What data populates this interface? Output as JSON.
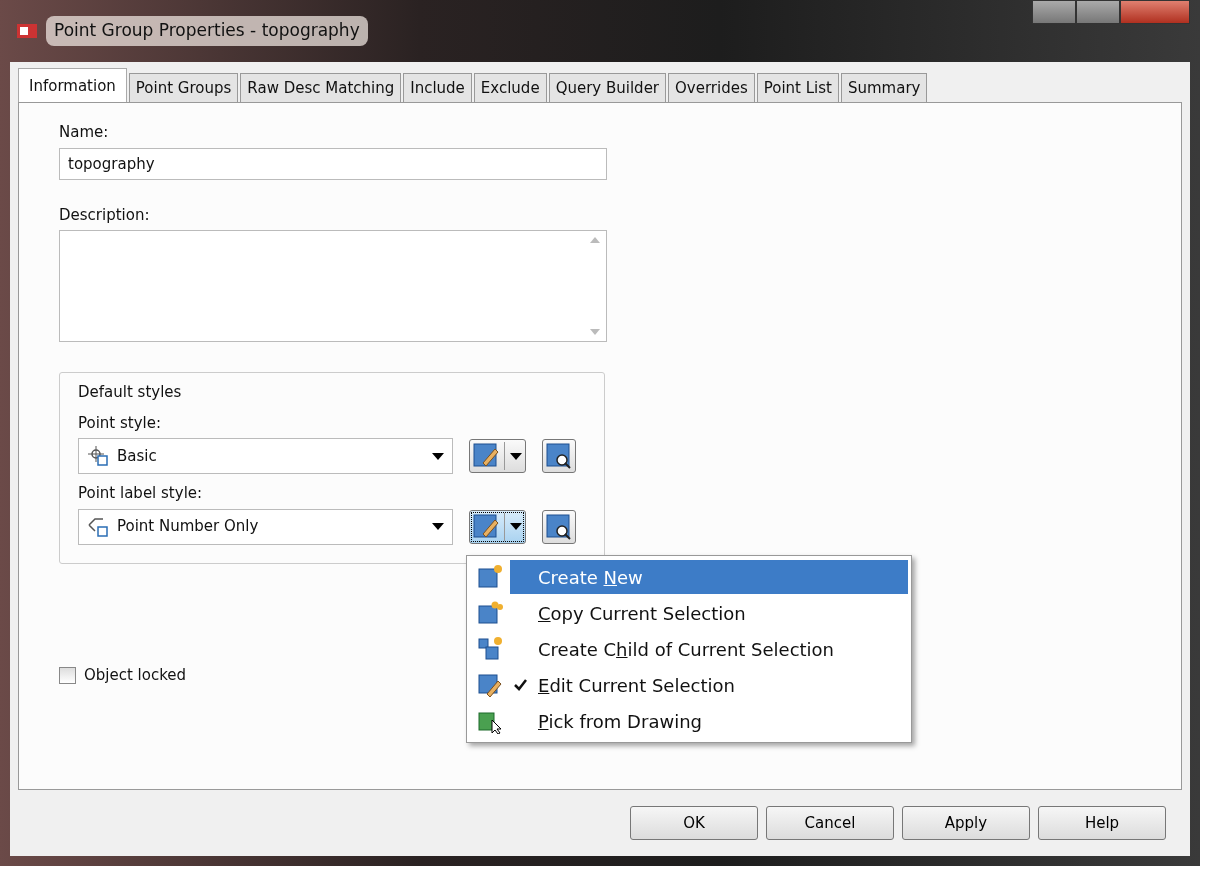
{
  "window": {
    "title": "Point Group Properties - topography"
  },
  "tabs": [
    {
      "label": "Information",
      "selected": true
    },
    {
      "label": "Point Groups",
      "selected": false
    },
    {
      "label": "Raw Desc Matching",
      "selected": false
    },
    {
      "label": "Include",
      "selected": false
    },
    {
      "label": "Exclude",
      "selected": false
    },
    {
      "label": "Query Builder",
      "selected": false
    },
    {
      "label": "Overrides",
      "selected": false
    },
    {
      "label": "Point List",
      "selected": false
    },
    {
      "label": "Summary",
      "selected": false
    }
  ],
  "name": {
    "label": "Name:",
    "value": "topography"
  },
  "description": {
    "label": "Description:"
  },
  "default_styles": {
    "title": "Default styles",
    "styles": [
      {
        "label": "Point style:",
        "value": "Basic",
        "kind": "point",
        "focused": false
      },
      {
        "label": "Point label style:",
        "value": "Point Number Only",
        "kind": "label",
        "focused": true
      }
    ]
  },
  "object_locked": {
    "label": "Object locked",
    "checked": false
  },
  "style_menu": {
    "items": [
      {
        "before": "Create ",
        "key": "N",
        "after": "ew",
        "kind": "new",
        "selected": true,
        "checked": false
      },
      {
        "key": "C",
        "after": "opy Current Selection",
        "kind": "copy",
        "selected": false,
        "checked": false
      },
      {
        "before": "Create C",
        "key": "h",
        "after": "ild of Current Selection",
        "kind": "child",
        "selected": false,
        "checked": false
      },
      {
        "key": "E",
        "after": "dit Current Selection",
        "kind": "edit",
        "selected": false,
        "checked": true
      },
      {
        "key": "P",
        "after": "ick from Drawing",
        "kind": "pick",
        "selected": false,
        "checked": false
      }
    ]
  },
  "buttons": [
    "OK",
    "Cancel",
    "Apply",
    "Help"
  ]
}
